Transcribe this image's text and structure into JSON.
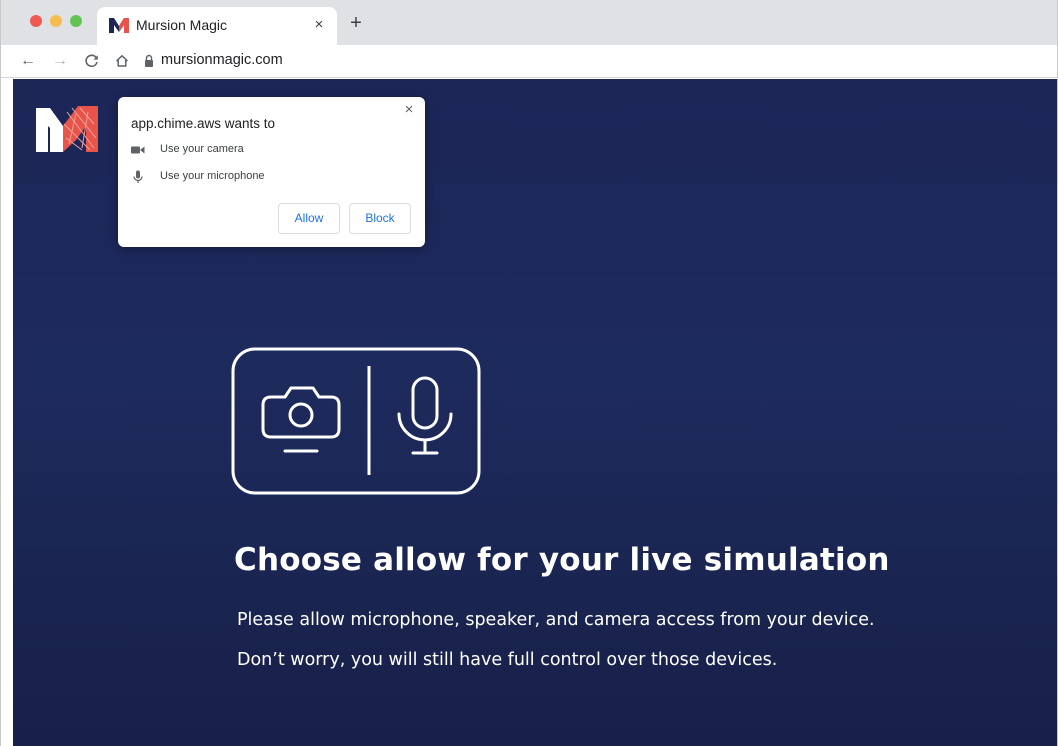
{
  "browser": {
    "tab": {
      "title": "Mursion Magic",
      "close_glyph": "×",
      "favicon": "mursion-m-icon"
    },
    "new_tab_glyph": "+",
    "nav": {
      "back_glyph": "←",
      "forward_glyph": "→",
      "reload_glyph": "C",
      "home_glyph": "⌂"
    },
    "url": "mursionmagic.com"
  },
  "permission_popup": {
    "title": "app.chime.aws wants to",
    "close_glyph": "×",
    "items": [
      {
        "icon": "video-camera-icon",
        "label": "Use your camera"
      },
      {
        "icon": "microphone-icon",
        "label": "Use your microphone"
      }
    ],
    "allow_label": "Allow",
    "block_label": "Block"
  },
  "page": {
    "title": "Choose allow for your live simulation",
    "line_1": "Please allow microphone, speaker, and camera access from your device.",
    "line_2": "Don’t worry, you will still have full control over those devices."
  },
  "colors": {
    "page_background": "#1c2657",
    "brand_red": "#e8534a",
    "link_blue": "#1a73e8"
  }
}
